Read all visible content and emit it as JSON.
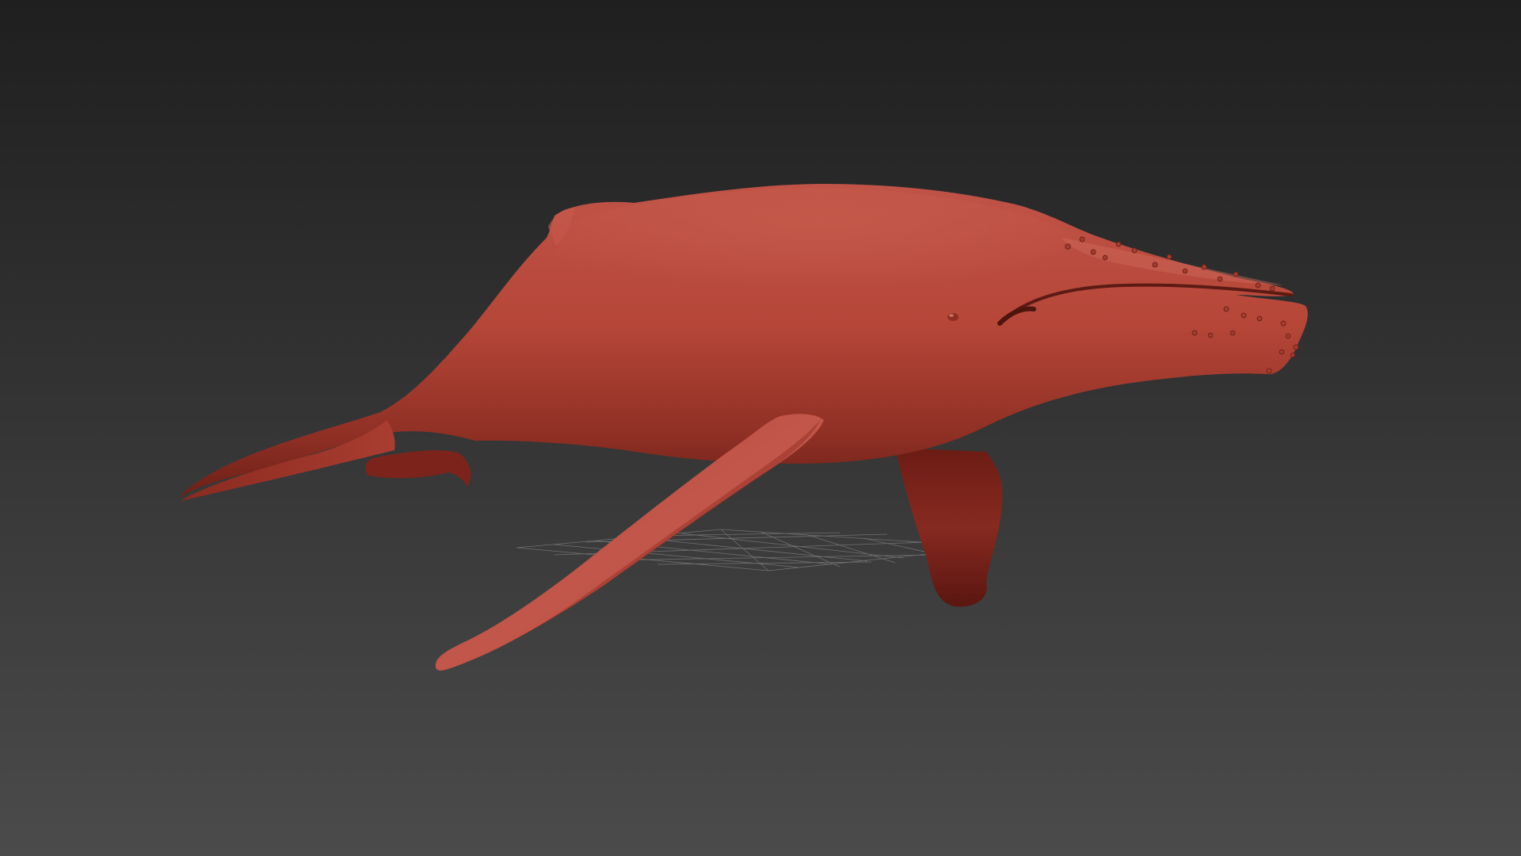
{
  "viewport": {
    "background_top": "#1f1f1f",
    "background_bottom": "#4b4b4b",
    "grid_color": "#9a9a9a",
    "shading_mode": "matcap clay"
  },
  "model": {
    "name": "humpback-whale",
    "base_color": "#b94b3f",
    "highlight_color": "#c65a4c",
    "shadow_color": "#5e1812"
  }
}
